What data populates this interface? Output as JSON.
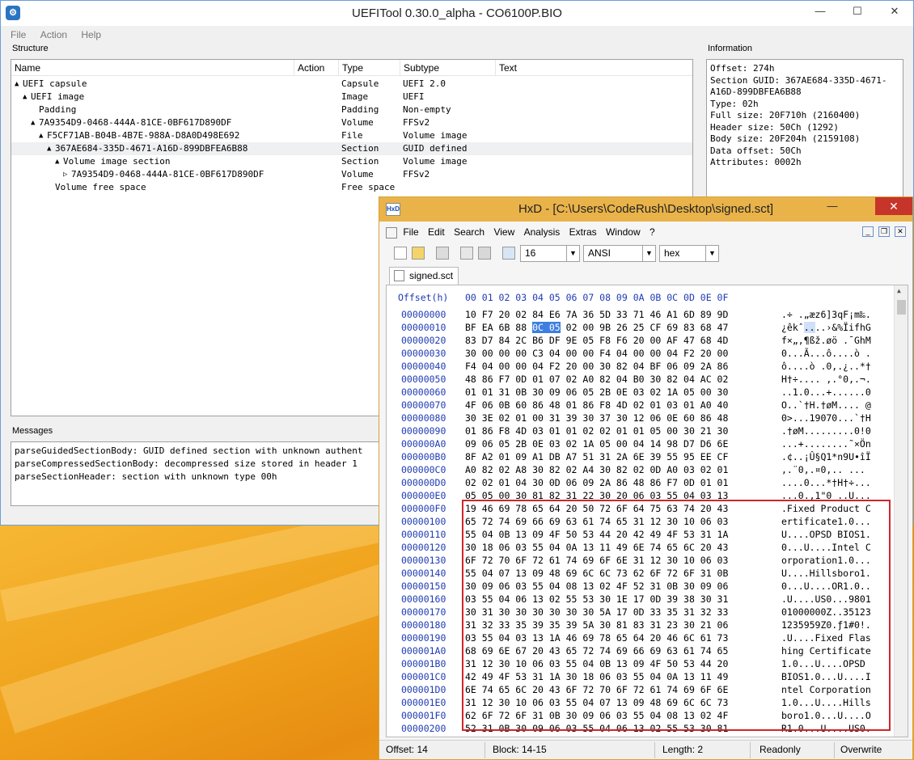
{
  "uefitool": {
    "title": "UEFITool 0.30.0_alpha - CO6100P.BIO",
    "app_icon": "gear-icon",
    "menu": [
      "File",
      "Action",
      "Help"
    ],
    "structure_label": "Structure",
    "information_label": "Information",
    "messages_label": "Messages",
    "columns": [
      "Name",
      "Action",
      "Type",
      "Subtype",
      "Text"
    ],
    "tree": [
      {
        "name": "UEFI capsule",
        "type": "Capsule",
        "subtype": "UEFI 2.0",
        "arrow": "▲",
        "level": 0
      },
      {
        "name": "UEFI image",
        "type": "Image",
        "subtype": "UEFI",
        "arrow": "▲",
        "level": 1
      },
      {
        "name": "Padding",
        "type": "Padding",
        "subtype": "Non-empty",
        "arrow": "",
        "level": 2
      },
      {
        "name": "7A9354D9-0468-444A-81CE-0BF617D890DF",
        "type": "Volume",
        "subtype": "FFSv2",
        "arrow": "▲",
        "level": 2
      },
      {
        "name": "F5CF71AB-B04B-4B7E-988A-D8A0D498E692",
        "type": "File",
        "subtype": "Volume image",
        "arrow": "▲",
        "level": 3
      },
      {
        "name": "367AE684-335D-4671-A16D-899DBFEA6B88",
        "type": "Section",
        "subtype": "GUID defined",
        "arrow": "▲",
        "level": 4,
        "selected": true
      },
      {
        "name": "Volume image section",
        "type": "Section",
        "subtype": "Volume image",
        "arrow": "▲",
        "level": 5
      },
      {
        "name": "7A9354D9-0468-444A-81CE-0BF617D890DF",
        "type": "Volume",
        "subtype": "FFSv2",
        "arrow": "▷",
        "level": 6
      },
      {
        "name": "Volume free space",
        "type": "Free space",
        "subtype": "",
        "arrow": "",
        "level": 4
      }
    ],
    "info": [
      "Offset: 274h",
      "Section GUID: 367AE684-335D-4671-",
      "A16D-899DBFEA6B88",
      "Type: 02h",
      "Full size: 20F710h (2160400)",
      "Header size: 50Ch (1292)",
      "Body size: 20F204h (2159108)",
      "Data offset: 50Ch",
      "Attributes: 0002h"
    ],
    "messages": [
      "parseGuidedSectionBody: GUID defined section with unknown authent",
      "parseCompressedSectionBody: decompressed size stored in header 1",
      "parseSectionHeader: section with unknown type 00h"
    ]
  },
  "hxd": {
    "title": "HxD - [C:\\Users\\CodeRush\\Desktop\\signed.sct]",
    "menu": [
      "File",
      "Edit",
      "Search",
      "View",
      "Analysis",
      "Extras",
      "Window",
      "?"
    ],
    "bytes_per_row": "16",
    "charset": "ANSI",
    "base": "hex",
    "tab": "signed.sct",
    "offset_header": "Offset(h)",
    "col_header": "00 01 02 03 04 05 06 07 08 09 0A 0B 0C 0D 0E 0F",
    "rows": [
      {
        "off": "00000000",
        "bytes": "10 F7 20 02 84 E6 7A 36 5D 33 71 46 A1 6D 89 9D",
        "asc": ".÷ .„æz6]3qF¡m‰."
      },
      {
        "off": "00000010",
        "bytes": "BF EA 6B 88 0C 05 02 00 9B 26 25 CF 69 83 68 47",
        "asc": "¿êkˆ....›&%ÏifhG"
      },
      {
        "off": "00000020",
        "bytes": "83 D7 84 2C B6 DF 9E 05 F8 F6 20 00 AF 47 68 4D",
        "asc": "f×„,¶ßž.øö .¯GhM"
      },
      {
        "off": "00000030",
        "bytes": "30 00 00 00 C3 04 00 00 F4 04 00 00 04 F2 20 00",
        "asc": "0...Ã...ô....ò ."
      },
      {
        "off": "00000040",
        "bytes": "F4 04 00 00 04 F2 20 00 30 82 04 BF 06 09 2A 86",
        "asc": "ô....ò .0‚.¿..*†"
      },
      {
        "off": "00000050",
        "bytes": "48 86 F7 0D 01 07 02 A0 82 04 B0 30 82 04 AC 02",
        "asc": "H†÷.... ‚.°0‚.¬."
      },
      {
        "off": "00000060",
        "bytes": "01 01 31 0B 30 09 06 05 2B 0E 03 02 1A 05 00 30",
        "asc": "..1.0...+......0"
      },
      {
        "off": "00000070",
        "bytes": "4F 06 0B 60 86 48 01 86 F8 4D 02 01 03 01 A0 40",
        "asc": "O..`†H.†øM.... @"
      },
      {
        "off": "00000080",
        "bytes": "30 3E 02 01 00 31 39 30 37 30 12 06 0E 60 86 48",
        "asc": "0>...19070...`†H"
      },
      {
        "off": "00000090",
        "bytes": "01 86 F8 4D 03 01 01 02 02 01 01 05 00 30 21 30",
        "asc": ".†øM.........0!0"
      },
      {
        "off": "000000A0",
        "bytes": "09 06 05 2B 0E 03 02 1A 05 00 04 14 98 D7 D6 6E",
        "asc": "...+........˜×Ön"
      },
      {
        "off": "000000B0",
        "bytes": "8F A2 01 09 A1 DB A7 51 31 2A 6E 39 55 95 EE CF",
        "asc": ".¢..¡Û§Q1*n9U•îÏ"
      },
      {
        "off": "000000C0",
        "bytes": "A0 82 02 A8 30 82 02 A4 30 82 02 0D A0 03 02 01",
        "asc": " ‚.¨0‚.¤0‚.. ..."
      },
      {
        "off": "000000D0",
        "bytes": "02 02 01 04 30 0D 06 09 2A 86 48 86 F7 0D 01 01",
        "asc": "....0...*†H†÷..."
      },
      {
        "off": "000000E0",
        "bytes": "05 05 00 30 81 82 31 22 30 20 06 03 55 04 03 13",
        "asc": "...0.‚1\"0 ..U..."
      },
      {
        "off": "000000F0",
        "bytes": "19 46 69 78 65 64 20 50 72 6F 64 75 63 74 20 43",
        "asc": ".Fixed Product C"
      },
      {
        "off": "00000100",
        "bytes": "65 72 74 69 66 69 63 61 74 65 31 12 30 10 06 03",
        "asc": "ertificate1.0..."
      },
      {
        "off": "00000110",
        "bytes": "55 04 0B 13 09 4F 50 53 44 20 42 49 4F 53 31 1A",
        "asc": "U....OPSD BIOS1."
      },
      {
        "off": "00000120",
        "bytes": "30 18 06 03 55 04 0A 13 11 49 6E 74 65 6C 20 43",
        "asc": "0...U....Intel C"
      },
      {
        "off": "00000130",
        "bytes": "6F 72 70 6F 72 61 74 69 6F 6E 31 12 30 10 06 03",
        "asc": "orporation1.0..."
      },
      {
        "off": "00000140",
        "bytes": "55 04 07 13 09 48 69 6C 6C 73 62 6F 72 6F 31 0B",
        "asc": "U....Hillsboro1."
      },
      {
        "off": "00000150",
        "bytes": "30 09 06 03 55 04 08 13 02 4F 52 31 0B 30 09 06",
        "asc": "0...U....OR1.0.."
      },
      {
        "off": "00000160",
        "bytes": "03 55 04 06 13 02 55 53 30 1E 17 0D 39 38 30 31",
        "asc": ".U....US0...9801"
      },
      {
        "off": "00000170",
        "bytes": "30 31 30 30 30 30 30 30 5A 17 0D 33 35 31 32 33",
        "asc": "01000000Z..35123"
      },
      {
        "off": "00000180",
        "bytes": "31 32 33 35 39 35 39 5A 30 81 83 31 23 30 21 06",
        "asc": "1235959Z0.ƒ1#0!."
      },
      {
        "off": "00000190",
        "bytes": "03 55 04 03 13 1A 46 69 78 65 64 20 46 6C 61 73",
        "asc": ".U....Fixed Flas"
      },
      {
        "off": "000001A0",
        "bytes": "68 69 6E 67 20 43 65 72 74 69 66 69 63 61 74 65",
        "asc": "hing Certificate"
      },
      {
        "off": "000001B0",
        "bytes": "31 12 30 10 06 03 55 04 0B 13 09 4F 50 53 44 20",
        "asc": "1.0...U....OPSD "
      },
      {
        "off": "000001C0",
        "bytes": "42 49 4F 53 31 1A 30 18 06 03 55 04 0A 13 11 49",
        "asc": "BIOS1.0...U....I"
      },
      {
        "off": "000001D0",
        "bytes": "6E 74 65 6C 20 43 6F 72 70 6F 72 61 74 69 6F 6E",
        "asc": "ntel Corporation"
      },
      {
        "off": "000001E0",
        "bytes": "31 12 30 10 06 03 55 04 07 13 09 48 69 6C 6C 73",
        "asc": "1.0...U....Hills"
      },
      {
        "off": "000001F0",
        "bytes": "62 6F 72 6F 31 0B 30 09 06 03 55 04 08 13 02 4F",
        "asc": "boro1.0...U....O"
      },
      {
        "off": "00000200",
        "bytes": "52 31 0B 30 09 06 03 55 04 06 13 02 55 53 30 81",
        "asc": "R1.0...U....US0."
      }
    ],
    "status": {
      "offset": "Offset: 14",
      "block": "Block: 14-15",
      "length": "Length: 2",
      "mode": "Readonly",
      "overwrite": "Overwrite"
    }
  }
}
